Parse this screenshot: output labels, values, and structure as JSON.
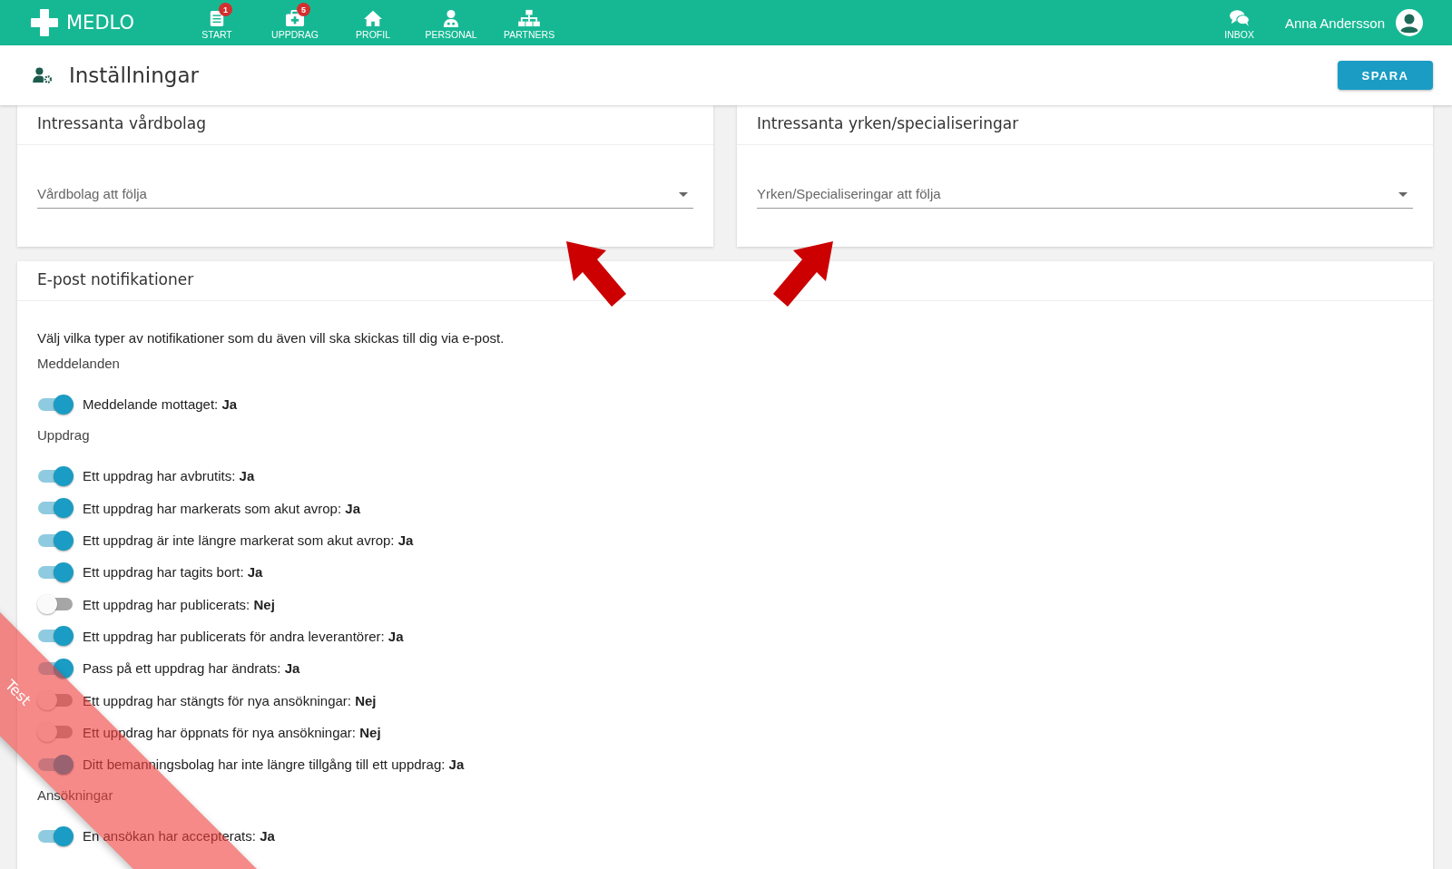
{
  "app": {
    "logo": "MEDLO"
  },
  "nav": [
    {
      "label": "START",
      "badge": "1"
    },
    {
      "label": "UPPDRAG",
      "badge": "5"
    },
    {
      "label": "PROFIL"
    },
    {
      "label": "PERSONAL"
    },
    {
      "label": "PARTNERS"
    }
  ],
  "inbox": {
    "label": "INBOX"
  },
  "user": {
    "name": "Anna Andersson"
  },
  "page": {
    "title": "Inställningar",
    "save_button": "SPARA"
  },
  "follow_cards": [
    {
      "title": "Intressanta vårdbolag",
      "placeholder": "Vårdbolag att följa"
    },
    {
      "title": "Intressanta yrken/specialiseringar",
      "placeholder": "Yrken/Specialiseringar att följa"
    }
  ],
  "notifications": {
    "title": "E-post notifikationer",
    "description": "Välj vilka typer av notifikationer som du även vill ska skickas till dig via e-post.",
    "groups": [
      {
        "title": "Meddelanden",
        "items": [
          {
            "label": "Meddelande mottaget: **Ja**",
            "on": true
          }
        ]
      },
      {
        "title": "Uppdrag",
        "items": [
          {
            "label": "Ett uppdrag har avbrutits: **Ja**",
            "on": true
          },
          {
            "label": "Ett uppdrag har markerats som akut avrop: **Ja**",
            "on": true
          },
          {
            "label": "Ett uppdrag är inte längre markerat som akut avrop: **Ja**",
            "on": true
          },
          {
            "label": "Ett uppdrag har tagits bort: **Ja**",
            "on": true
          },
          {
            "label": "Ett uppdrag har publicerats: **Nej**",
            "on": false
          },
          {
            "label": "Ett uppdrag har publicerats för andra leverantörer: **Ja**",
            "on": true
          },
          {
            "label": "Pass på ett uppdrag har ändrats: **Ja**",
            "on": true
          },
          {
            "label": "Ett uppdrag har stängts för nya ansökningar: **Nej**",
            "on": false
          },
          {
            "label": "Ett uppdrag har öppnats för nya ansökningar: **Nej**",
            "on": false
          },
          {
            "label": "Ditt bemanningsbolag har inte längre tillgång till ett uppdrag: **Ja**",
            "on": true
          }
        ]
      },
      {
        "title": "Ansökningar",
        "items": [
          {
            "label": "En ansökan har accepterats: **Ja**",
            "on": true
          }
        ]
      }
    ]
  },
  "ribbon": {
    "label": "Test"
  }
}
